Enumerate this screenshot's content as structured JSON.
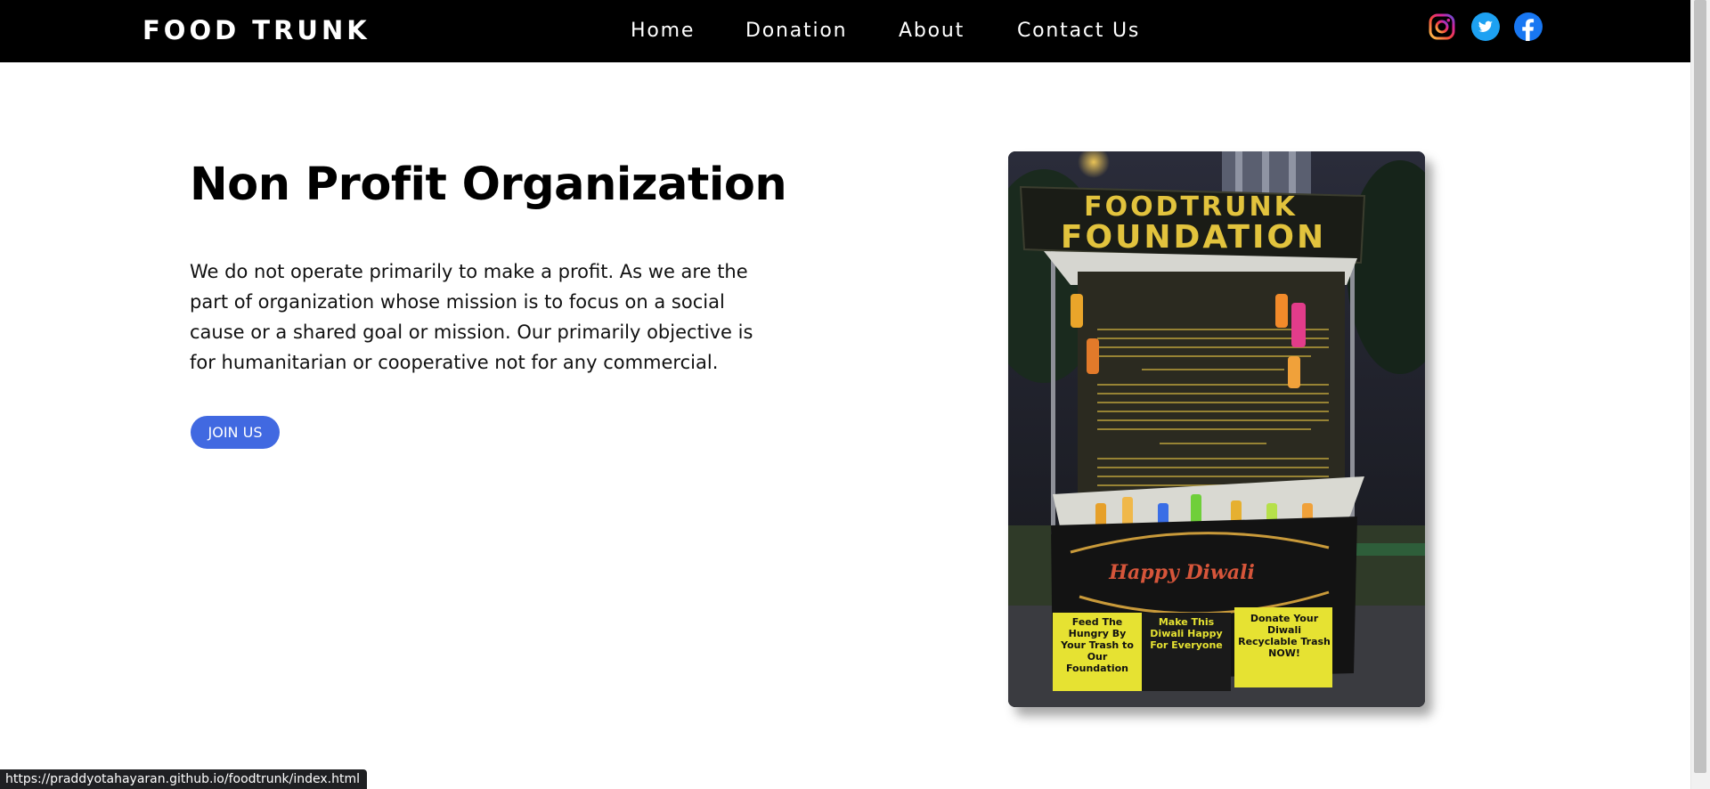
{
  "navbar": {
    "brand": "FOOD TRUNK",
    "links": [
      "Home",
      "Donation",
      "About",
      "Contact Us"
    ],
    "social_icons": [
      "instagram-icon",
      "twitter-icon",
      "facebook-icon"
    ]
  },
  "hero": {
    "title": "Non Profit Organization",
    "description": "We do not operate primarily to make a profit. As we are the part of organization whose mission is to focus on a social cause or a shared goal or mission. Our primarily objective is for humanitarian or cooperative not for any commercial.",
    "button_label": "JOIN US"
  },
  "photo": {
    "banner_line1": "FOODTRUNK",
    "banner_line2": "FOUNDATION",
    "center_banner": "Happy Diwali",
    "poster1": "Feed The Hungry By Your Trash to Our Foundation",
    "poster2": "Make This Diwali Happy For Everyone",
    "poster3": "Donate Your Diwali Recyclable Trash NOW!"
  },
  "status_bar": {
    "url": "https://praddyotahayaran.github.io/foodtrunk/index.html"
  },
  "colors": {
    "navbar_bg": "#000000",
    "button_bg": "#4169e1",
    "page_bg": "#ffffff",
    "instagram": "#d6249f",
    "twitter": "#1da1f2",
    "facebook": "#1877f2"
  }
}
